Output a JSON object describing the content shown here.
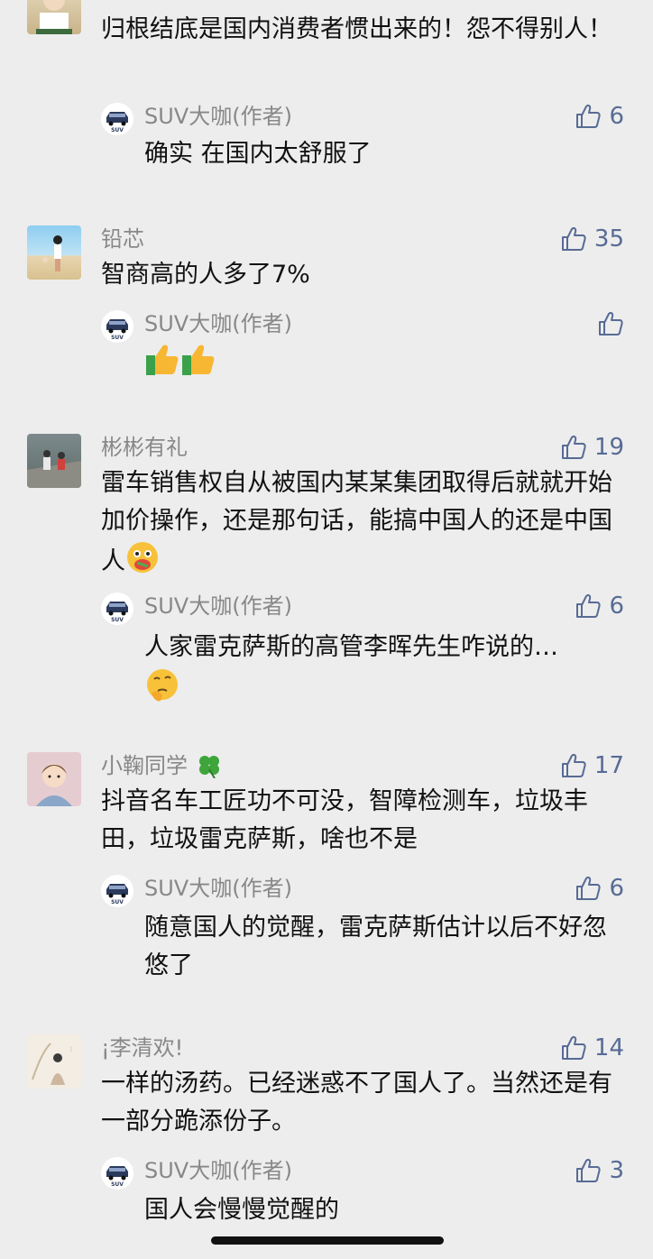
{
  "comments": [
    {
      "name": "",
      "likes": "",
      "text": "归根结底是国内消费者惯出来的！怨不得别人！",
      "reply": {
        "name": "SUV大咖(作者)",
        "likes": "6",
        "text": "确实 在国内太舒服了"
      }
    },
    {
      "name": "铅芯",
      "likes": "35",
      "text": "智商高的人多了7%",
      "reply": {
        "name": "SUV大咖(作者)",
        "likes": "",
        "text": ""
      }
    },
    {
      "name": "彬彬有礼",
      "likes": "19",
      "text": "雷车销售权自从被国内某某集团取得后就就开始加价操作，还是那句话，能搞中国人的还是中国人",
      "reply": {
        "name": "SUV大咖(作者)",
        "likes": "6",
        "text": "人家雷克萨斯的高管李晖先生咋说的…"
      }
    },
    {
      "name": "小鞠同学",
      "likes": "17",
      "text": "抖音名车工匠功不可没，智障检测车，垃圾丰田，垃圾雷克萨斯，啥也不是",
      "reply": {
        "name": "SUV大咖(作者)",
        "likes": "6",
        "text": "随意国人的觉醒，雷克萨斯估计以后不好忽悠了"
      }
    },
    {
      "name": "¡李清欢!",
      "likes": "14",
      "text": "一样的汤药。已经迷惑不了国人了。当然还是有一部分跪添份子。",
      "reply": {
        "name": "SUV大咖(作者)",
        "likes": "3",
        "text": "国人会慢慢觉醒的"
      }
    }
  ],
  "colors": {
    "background": "#ededed",
    "like": "#576b95",
    "name": "#888888"
  }
}
